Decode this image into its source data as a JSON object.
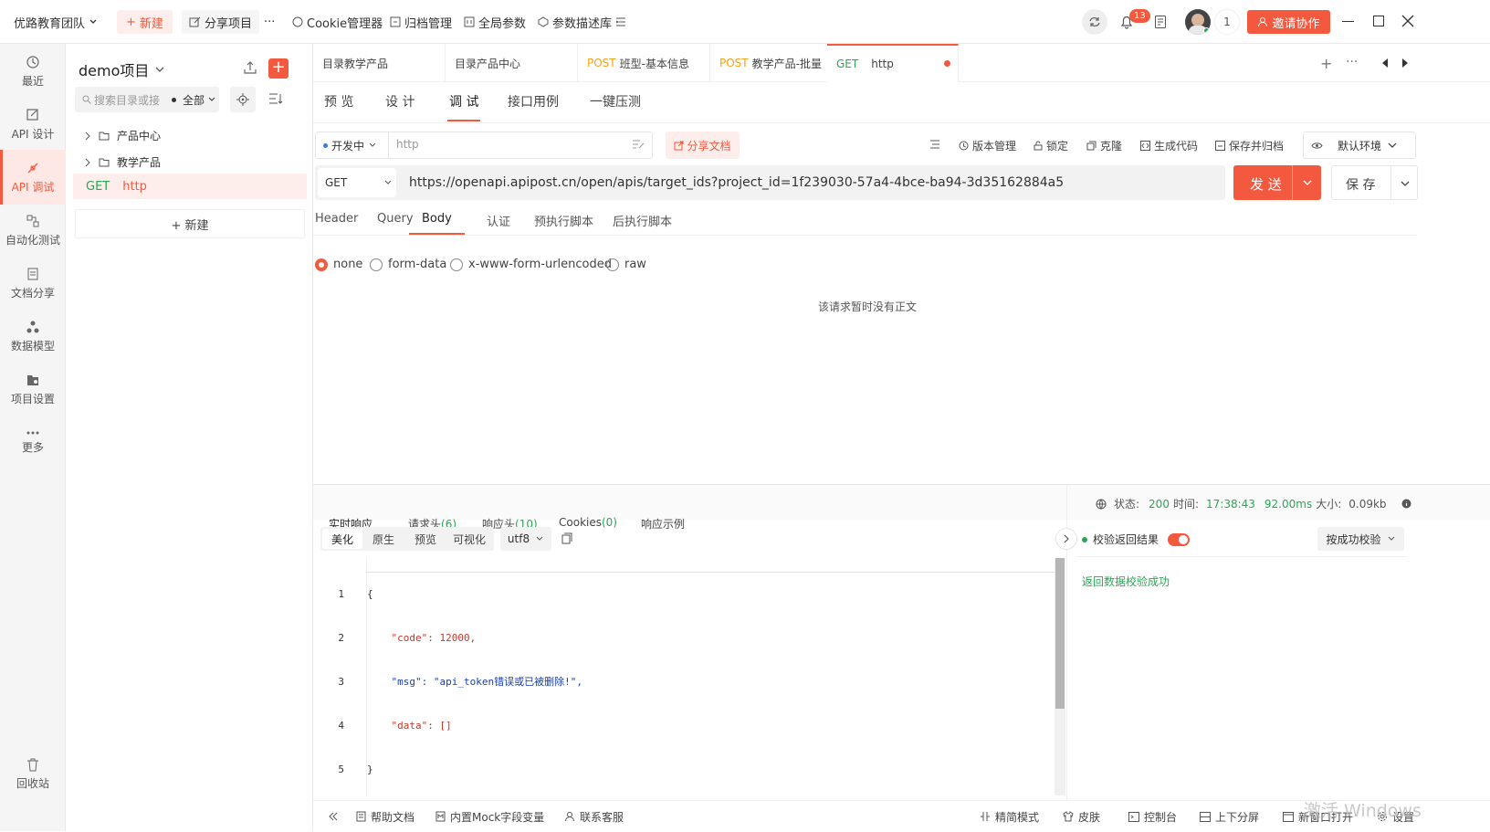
{
  "colors": {
    "accent": "#f2593f",
    "get": "#2aa653",
    "post": "#f2a01c",
    "link": "#2aa653"
  },
  "topbar": {
    "team": "优路教育团队",
    "new_label": "新建",
    "share_label": "分享项目",
    "more": "···",
    "cookie_label": "Cookie管理器",
    "archive_label": "归档管理",
    "global_label": "全局参数",
    "params_label": "参数描述库",
    "notif_count": "13",
    "user_count": "1",
    "invite_label": "邀请协作"
  },
  "nav": [
    {
      "label": "最近",
      "icon": "clock-icon"
    },
    {
      "label": "API 设计",
      "icon": "design-icon"
    },
    {
      "label": "API 调试",
      "icon": "debug-icon"
    },
    {
      "label": "自动化测试",
      "icon": "auto-test-icon"
    },
    {
      "label": "文档分享",
      "icon": "doc-share-icon"
    },
    {
      "label": "数据模型",
      "icon": "model-icon"
    },
    {
      "label": "项目设置",
      "icon": "settings-icon"
    },
    {
      "label": "更多",
      "icon": "more-icon"
    },
    {
      "label": "回收站",
      "icon": "trash-icon"
    }
  ],
  "tree": {
    "project": "demo项目",
    "search_placeholder": "搜索目录或接",
    "filter": "全部",
    "folders": [
      "产品中心",
      "教学产品"
    ],
    "item_method": "GET",
    "item_name": "http",
    "new_label": "+ 新建"
  },
  "tabs": [
    {
      "method": "",
      "name": "目录教学产品"
    },
    {
      "method": "",
      "name": "目录产品中心"
    },
    {
      "method": "POST",
      "name": "班型-基本信息"
    },
    {
      "method": "POST",
      "name": "教学产品-批量"
    },
    {
      "method": "GET",
      "name": "http"
    }
  ],
  "subtabs": [
    "预 览",
    "设 计",
    "调 试",
    "接口用例",
    "一键压测"
  ],
  "request": {
    "env": "开发中",
    "name": "http",
    "share_doc": "分享文档",
    "version": "版本管理",
    "lock": "锁定",
    "clone": "克隆",
    "gen_code": "生成代码",
    "save_archive": "保存并归档",
    "default_env": "默认环境",
    "method": "GET",
    "url": "https://openapi.apipost.cn/open/apis/target_ids?project_id=1f239030-57a4-4bce-ba94-3d35162884a5",
    "send": "发 送",
    "save": "保 存"
  },
  "body_tabs": [
    "Header",
    "Query",
    "Body",
    "认证",
    "预执行脚本",
    "后执行脚本"
  ],
  "body_opts": [
    "none",
    "form-data",
    "x-www-form-urlencoded",
    "raw"
  ],
  "body_empty": "该请求暂时没有正文",
  "resp": {
    "tabs": [
      "实时响应",
      "请求头",
      "响应头",
      "Cookies",
      "响应示例"
    ],
    "counts": [
      "",
      "(6)",
      "(10)",
      "(0)",
      ""
    ],
    "status_label": "状态:",
    "status": "200",
    "time_label": "时间:",
    "time": "17:38:43",
    "ms": "92.00ms",
    "size_label": "大小:",
    "size": "0.09kb",
    "view_tabs": [
      "美化",
      "原生",
      "预览",
      "可视化"
    ],
    "encoding": "utf8",
    "line_numbers": [
      "1",
      "2",
      "3",
      "4",
      "5"
    ],
    "lines": [
      "{",
      "    \"code\": 12000,",
      "    \"msg\": \"api_token错误或已被删除!\",",
      "    \"data\": []",
      "}"
    ],
    "validate_label": "校验返回结果",
    "validate_mode": "按成功校验",
    "validate_result": "返回数据校验成功"
  },
  "footer": [
    "帮助文档",
    "内置Mock字段变量",
    "联系客服",
    "精简模式",
    "皮肤",
    "控制台",
    "上下分屏",
    "新窗口打开",
    "设置"
  ],
  "watermark": "激活 Windows"
}
